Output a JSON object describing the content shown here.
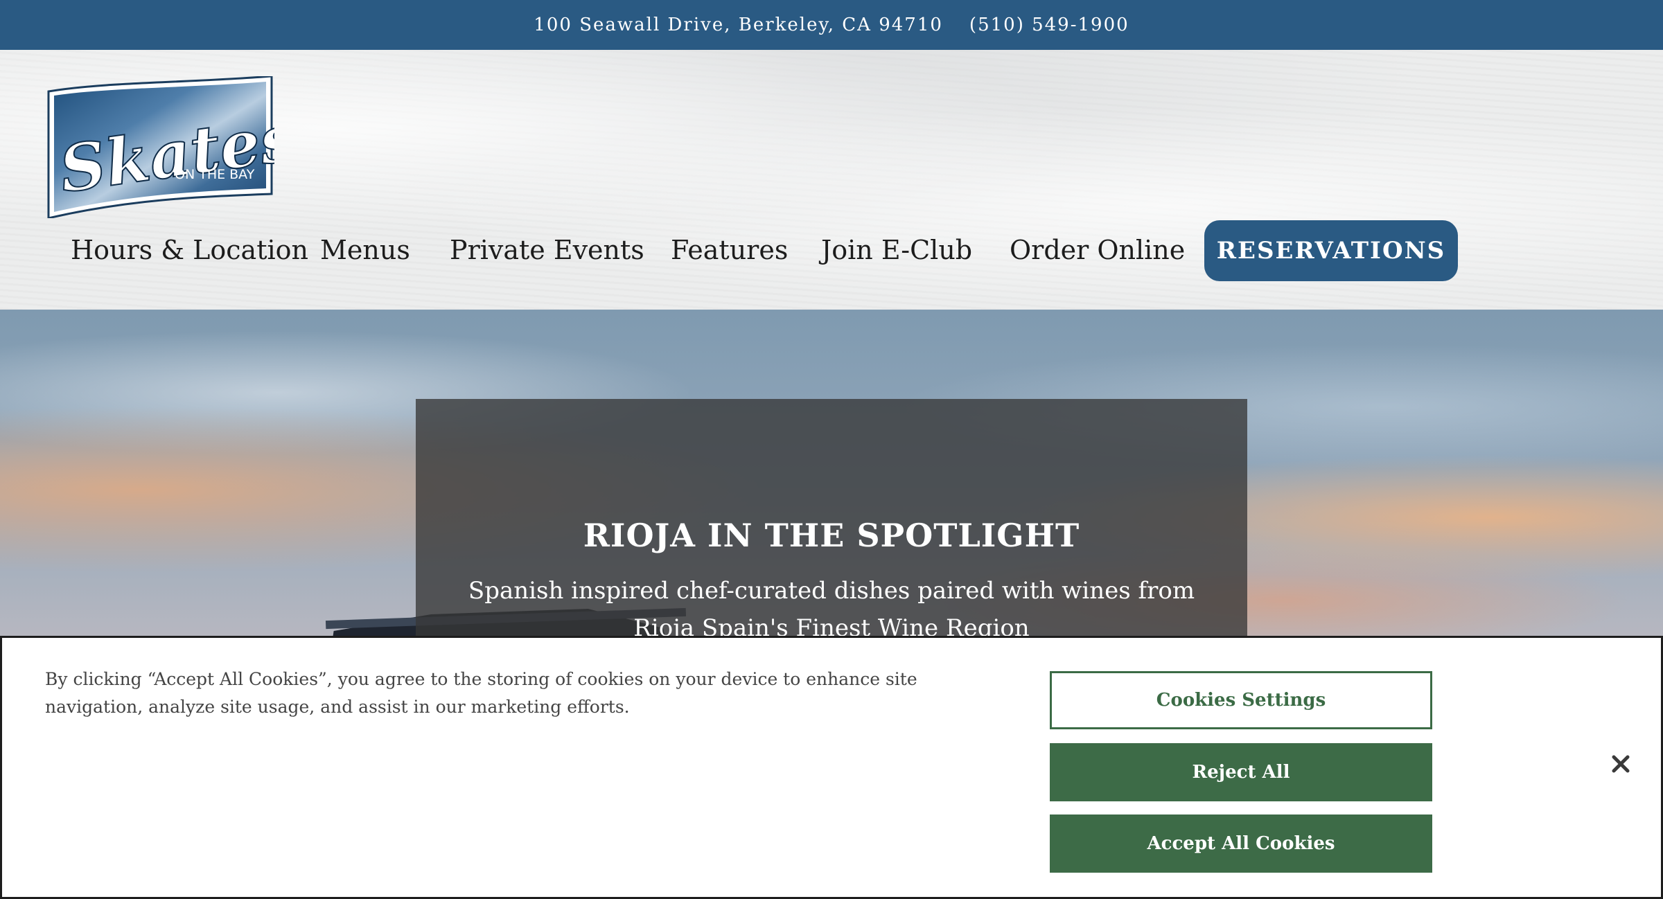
{
  "topbar": {
    "address": "100 Seawall Drive, Berkeley, CA 94710",
    "phone": "(510) 549-1900"
  },
  "logo": {
    "name": "Skates",
    "tagline": "ON THE BAY"
  },
  "nav": {
    "items": [
      {
        "label": "Hours & Location"
      },
      {
        "label": "Menus"
      },
      {
        "label": "Private Events"
      },
      {
        "label": "Features"
      },
      {
        "label": "Join E-Club"
      },
      {
        "label": "Order Online"
      }
    ],
    "reservations_label": "RESERVATIONS"
  },
  "hero": {
    "title": "RIOJA IN THE SPOTLIGHT",
    "subtitle": "Spanish inspired chef-curated dishes paired with wines from Rioja Spain's Finest Wine Region"
  },
  "cookie_banner": {
    "text": "By clicking “Accept All Cookies”, you agree to the storing of cookies on your device to enhance site navigation, analyze site usage, and assist in our marketing efforts.",
    "settings_label": "Cookies Settings",
    "reject_label": "Reject All",
    "accept_label": "Accept All Cookies"
  },
  "colors": {
    "brand_blue": "#2a5a83",
    "cookie_green": "#3d6b47"
  }
}
